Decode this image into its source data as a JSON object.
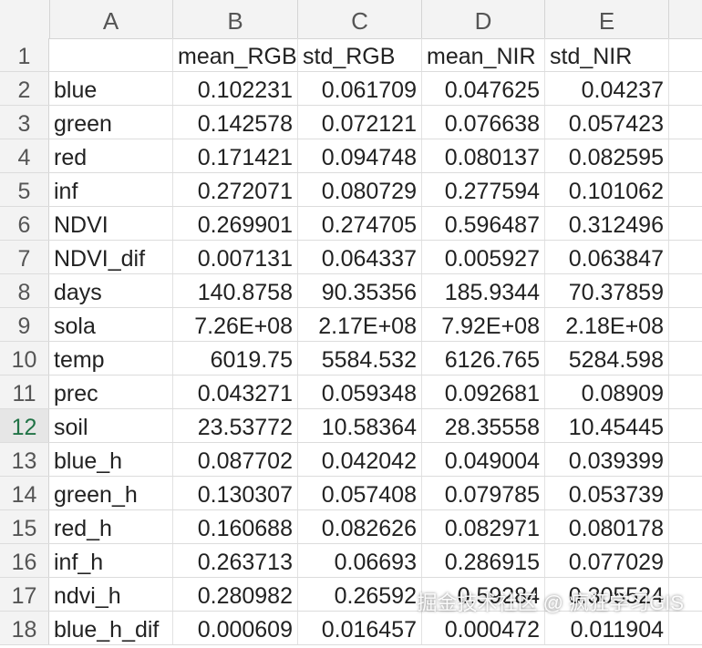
{
  "columns": [
    "A",
    "B",
    "C",
    "D",
    "E"
  ],
  "header_row": {
    "num": "1",
    "cells": [
      "",
      "mean_RGB",
      "std_RGB",
      "mean_NIR",
      "std_NIR"
    ]
  },
  "rows": [
    {
      "num": "2",
      "label": "blue",
      "values": [
        "0.102231",
        "0.061709",
        "0.047625",
        "0.04237"
      ]
    },
    {
      "num": "3",
      "label": "green",
      "values": [
        "0.142578",
        "0.072121",
        "0.076638",
        "0.057423"
      ]
    },
    {
      "num": "4",
      "label": "red",
      "values": [
        "0.171421",
        "0.094748",
        "0.080137",
        "0.082595"
      ]
    },
    {
      "num": "5",
      "label": "inf",
      "values": [
        "0.272071",
        "0.080729",
        "0.277594",
        "0.101062"
      ]
    },
    {
      "num": "6",
      "label": "NDVI",
      "values": [
        "0.269901",
        "0.274705",
        "0.596487",
        "0.312496"
      ]
    },
    {
      "num": "7",
      "label": "NDVI_dif",
      "values": [
        "0.007131",
        "0.064337",
        "0.005927",
        "0.063847"
      ]
    },
    {
      "num": "8",
      "label": "days",
      "values": [
        "140.8758",
        "90.35356",
        "185.9344",
        "70.37859"
      ]
    },
    {
      "num": "9",
      "label": "sola",
      "values": [
        "7.26E+08",
        "2.17E+08",
        "7.92E+08",
        "2.18E+08"
      ]
    },
    {
      "num": "10",
      "label": "temp",
      "values": [
        "6019.75",
        "5584.532",
        "6126.765",
        "5284.598"
      ]
    },
    {
      "num": "11",
      "label": "prec",
      "values": [
        "0.043271",
        "0.059348",
        "0.092681",
        "0.08909"
      ]
    },
    {
      "num": "12",
      "label": "soil",
      "values": [
        "23.53772",
        "10.58364",
        "28.35558",
        "10.45445"
      ]
    },
    {
      "num": "13",
      "label": "blue_h",
      "values": [
        "0.087702",
        "0.042042",
        "0.049004",
        "0.039399"
      ]
    },
    {
      "num": "14",
      "label": "green_h",
      "values": [
        "0.130307",
        "0.057408",
        "0.079785",
        "0.053739"
      ]
    },
    {
      "num": "15",
      "label": "red_h",
      "values": [
        "0.160688",
        "0.082626",
        "0.082971",
        "0.080178"
      ]
    },
    {
      "num": "16",
      "label": "inf_h",
      "values": [
        "0.263713",
        "0.06693",
        "0.286915",
        "0.077029"
      ]
    },
    {
      "num": "17",
      "label": "ndvi_h",
      "values": [
        "0.280982",
        "0.26592",
        "0.59284",
        "0.305524"
      ]
    },
    {
      "num": "18",
      "label": "blue_h_dif",
      "values": [
        "0.000609",
        "0.016457",
        "0.000472",
        "0.011904"
      ]
    }
  ],
  "active_row": "12",
  "watermark": "掘金技术社区 @ 疯狂学习GIS"
}
